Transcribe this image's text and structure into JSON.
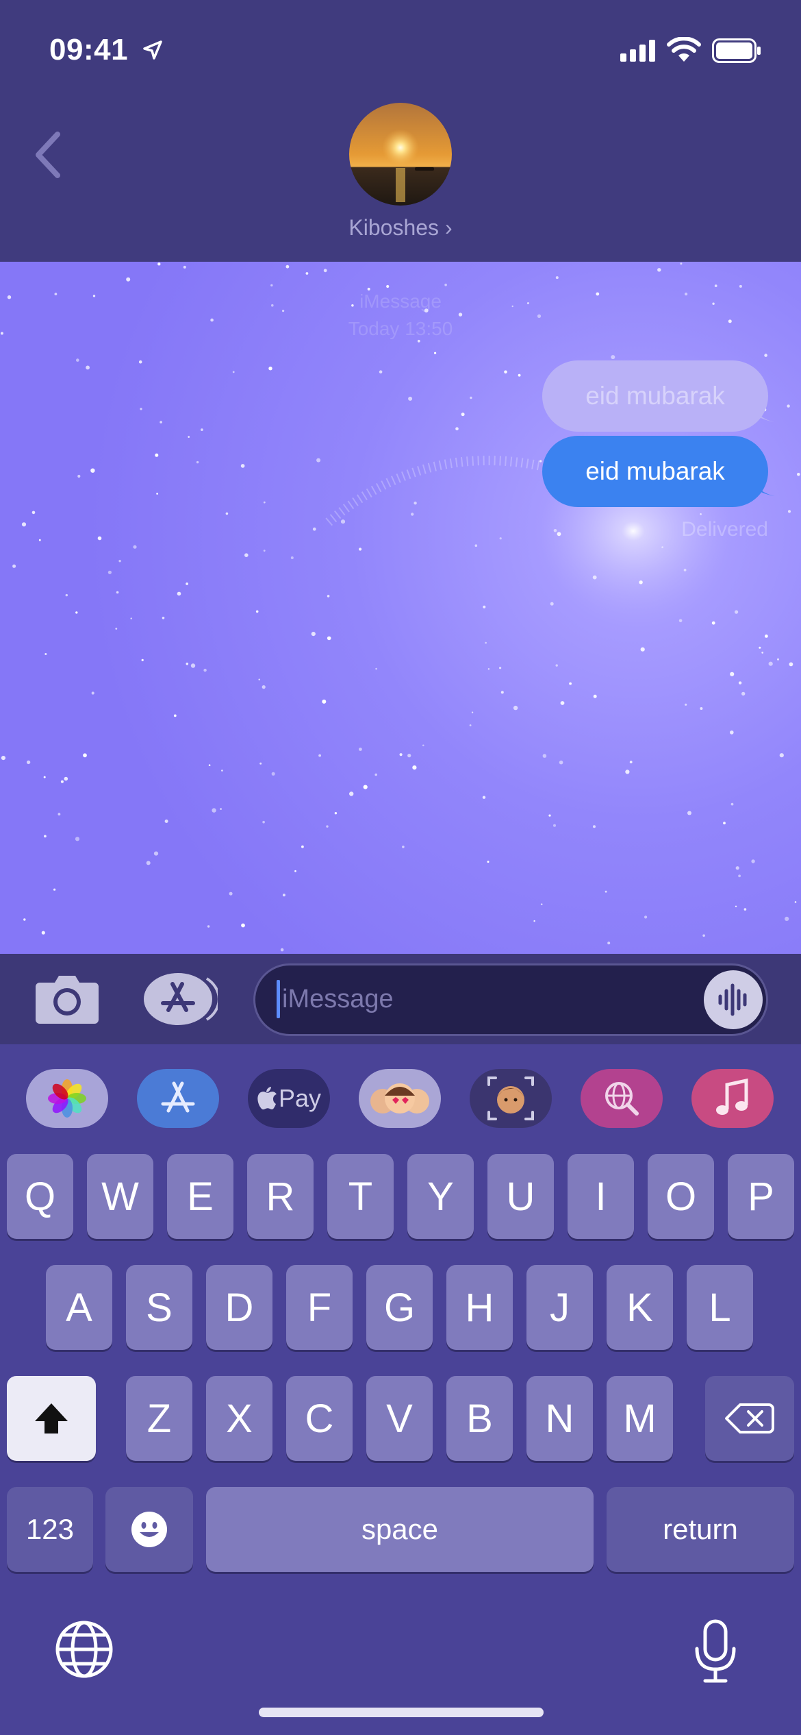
{
  "status_bar": {
    "time": "09:41",
    "icons": [
      "location-arrow-icon",
      "cellular-signal-icon",
      "wifi-icon",
      "battery-icon"
    ]
  },
  "header": {
    "back_icon": "chevron-left-icon",
    "contact_name": "Kiboshes",
    "contact_chevron": "›"
  },
  "chat": {
    "service": "iMessage",
    "timestamp": "Today 13:50",
    "messages": [
      {
        "text": "eid mubarak",
        "style": "ghost"
      },
      {
        "text": "eid mubarak",
        "style": "sent"
      }
    ],
    "status": "Delivered"
  },
  "input_bar": {
    "camera_icon": "camera-icon",
    "apps_icon": "app-store-icon",
    "placeholder": "iMessage",
    "audio_icon": "waveform-icon"
  },
  "app_drawer": {
    "apps": [
      {
        "name": "photos",
        "label": ""
      },
      {
        "name": "app-store",
        "label": ""
      },
      {
        "name": "apple-pay",
        "label": "Pay"
      },
      {
        "name": "memoji-stickers",
        "label": ""
      },
      {
        "name": "memoji",
        "label": ""
      },
      {
        "name": "images-search",
        "label": ""
      },
      {
        "name": "music",
        "label": ""
      }
    ]
  },
  "keyboard": {
    "row1": [
      "Q",
      "W",
      "E",
      "R",
      "T",
      "Y",
      "U",
      "I",
      "O",
      "P"
    ],
    "row2": [
      "A",
      "S",
      "D",
      "F",
      "G",
      "H",
      "J",
      "K",
      "L"
    ],
    "row3": [
      "Z",
      "X",
      "C",
      "V",
      "B",
      "N",
      "M"
    ],
    "numbers_label": "123",
    "space_label": "space",
    "return_label": "return"
  },
  "colors": {
    "header_bg": "#403b7e",
    "chat_bg": "#8577f7",
    "bubble_sent": "#3b82f0",
    "keyboard_bg": "#4a4397",
    "key_bg": "#807bbd"
  }
}
